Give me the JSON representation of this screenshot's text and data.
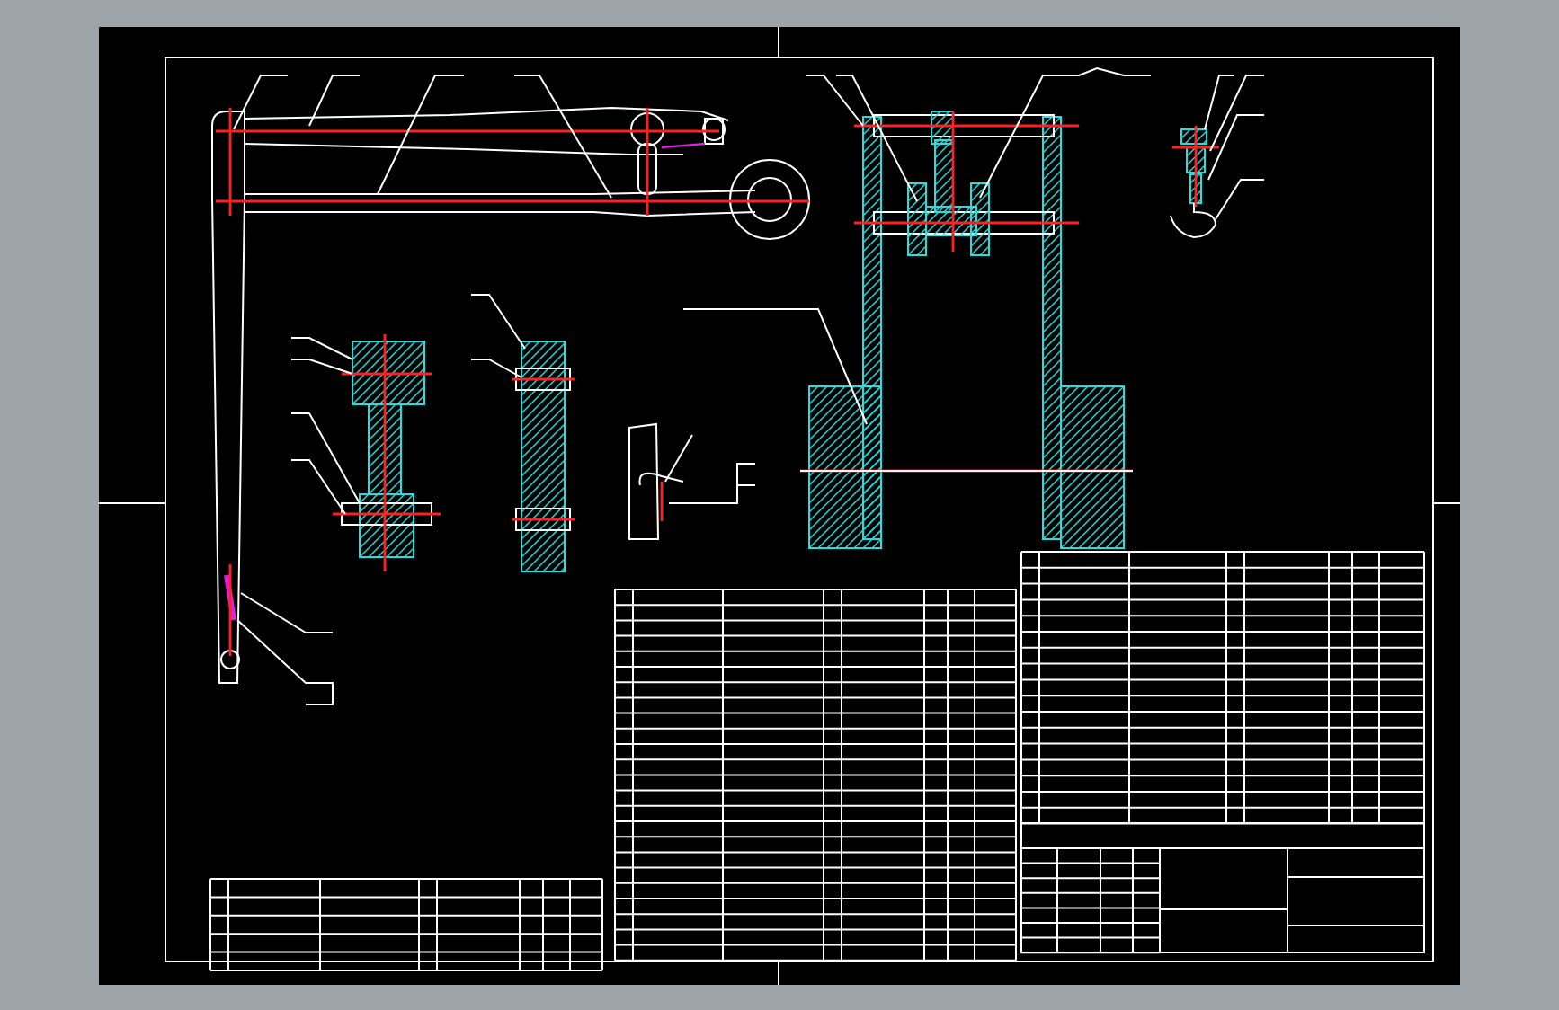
{
  "drawing_sheet": {
    "views": [
      {
        "kind": "boom"
      },
      {
        "kind": "trolley"
      },
      {
        "kind": "hook"
      },
      {
        "kind": "gear-shaft"
      },
      {
        "kind": "bearing-bar"
      },
      {
        "kind": "clamp"
      }
    ],
    "tables": [
      {
        "kind": "small-parts-list"
      },
      {
        "kind": "middle-parts-list"
      },
      {
        "kind": "right-parts-list"
      },
      {
        "kind": "title-block"
      }
    ]
  }
}
